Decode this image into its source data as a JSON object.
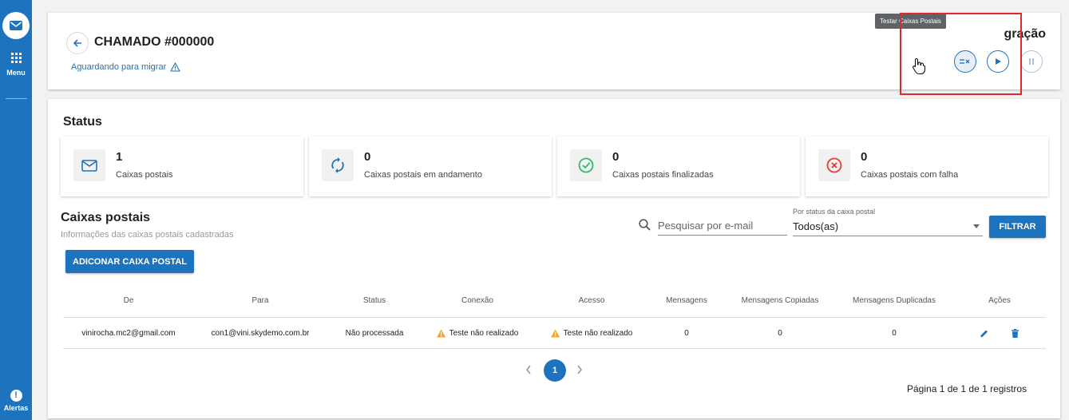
{
  "sidebar": {
    "menu_label": "Menu",
    "alerts_label": "Alertas",
    "alerts_badge": "!"
  },
  "header": {
    "title": "CHAMADO #000000",
    "status": "Aguardando para migrar",
    "right_title": "gração",
    "tooltip": "Testar Caixas Postais"
  },
  "status_section": {
    "title": "Status",
    "cards": [
      {
        "value": "1",
        "label": "Caixas postais",
        "icon": "mail-icon"
      },
      {
        "value": "0",
        "label": "Caixas postais em andamento",
        "icon": "sync-icon"
      },
      {
        "value": "0",
        "label": "Caixas postais finalizadas",
        "icon": "check-circle-icon"
      },
      {
        "value": "0",
        "label": "Caixas postais com falha",
        "icon": "error-circle-icon"
      }
    ]
  },
  "mailboxes": {
    "title": "Caixas postais",
    "subtitle": "Informações das caixas postais cadastradas",
    "search_placeholder": "Pesquisar por e-mail",
    "filter_caption": "Por status da caixa postal",
    "filter_value": "Todos(as)",
    "filter_button": "FILTRAR",
    "add_button": "ADICONAR CAIXA POSTAL",
    "columns": [
      "De",
      "Para",
      "Status",
      "Conexão",
      "Acesso",
      "Mensagens",
      "Mensagens Copiadas",
      "Mensagens Duplicadas",
      "Ações"
    ],
    "rows": [
      [
        "vinirocha.mc2@gmail.com",
        "con1@vini.skydemo.com.br",
        "Não processada",
        "Teste não realizado",
        "Teste não realizado",
        "0",
        "0",
        "0"
      ]
    ]
  },
  "pagination": {
    "current_page": "1",
    "info": "Página 1 de 1 de 1 registros"
  },
  "colors": {
    "primary": "#1e73be",
    "success": "#2ebd6b",
    "danger": "#e53935",
    "warning": "#f5a623",
    "highlight": "#e0292e"
  }
}
